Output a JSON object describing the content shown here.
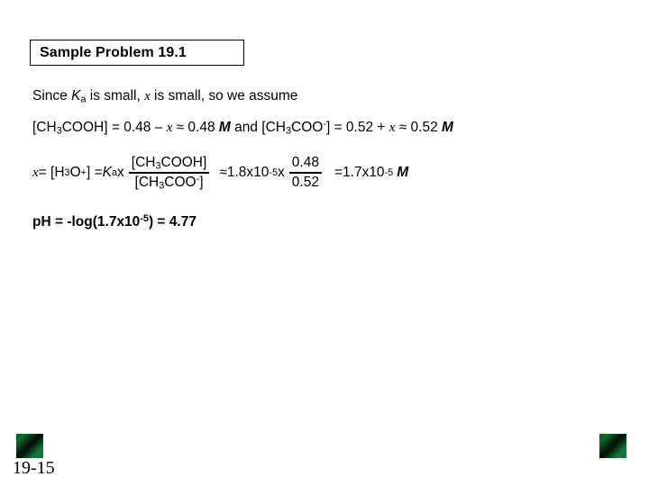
{
  "slide": {
    "background_color": "#ffffff",
    "text_color": "#000000"
  },
  "title": {
    "label": "Sample Problem 19.1"
  },
  "assumption_line": {
    "prefix": "Since ",
    "ka_symbol": "K",
    "ka_subscript": "a",
    "middle": " is small, ",
    "variable": "x",
    "suffix": " is small, so we assume",
    "full_text": "Since Ka is small, x is small, so we assume"
  },
  "concentration_line": {
    "acid_open": "[CH",
    "acid_sub1": "3",
    "acid_mid": "COOH] = 0.48 – ",
    "acid_var": "x",
    "acid_approx": " ≈ 0.48 ",
    "acid_unit": "M",
    "conjunction": " and ",
    "base_open": "[CH",
    "base_sub1": "3",
    "base_mid": "COO",
    "base_charge": "-",
    "base_eq": "] = 0.52 + ",
    "base_var": "x",
    "base_approx": " ≈ 0.52 ",
    "base_unit": "M",
    "full_text": "[CH3COOH] = 0.48 – x ≈ 0.48 M and [CH3COO-] = 0.52 + x ≈ 0.52 M"
  },
  "main_equation": {
    "var": "x",
    "equals1": " = [H",
    "hydronium_sub": "3",
    "hydronium_mid": "O",
    "hydronium_charge": "+",
    "equals2": "] = ",
    "ka_symbol": "K",
    "ka_subscript": "a",
    "times1": " x",
    "fraction1": {
      "numerator_open": "[CH",
      "numerator_sub": "3",
      "numerator_rest": "COOH]",
      "numerator_text": "[CH3COOH]",
      "denominator_open": "[CH",
      "denominator_sub": "3",
      "denominator_rest": "COO",
      "denominator_charge": "-",
      "denominator_close": "]",
      "denominator_text": "[CH3COO-]"
    },
    "approx": "≈ ",
    "ka_value_mantissa": "1.8x10",
    "ka_value_exponent": "-5",
    "times2": " x",
    "fraction2": {
      "numerator": "0.48",
      "denominator": "0.52"
    },
    "result_equals": "= ",
    "result_mantissa": "1.7x10",
    "result_exponent": "-5",
    "result_unit": "M",
    "full_text": "x = [H3O+] = Ka x [CH3COOH]/[CH3COO-] ≈ 1.8x10-5 x 0.48/0.52 = 1.7x10-5 M"
  },
  "ph_line": {
    "prefix": "pH = -log(1.7x10",
    "exponent": "-5",
    "suffix": ") = 4.77",
    "full_text": "pH = -log(1.7x10-5) = 4.77"
  },
  "decorations": {
    "green_square_color": "#0d5c2a",
    "green_square_dark": "#021109",
    "left_icon_name": "green-gradient-square",
    "right_icon_name": "green-gradient-square"
  },
  "footer": {
    "page_number": "19-15"
  }
}
